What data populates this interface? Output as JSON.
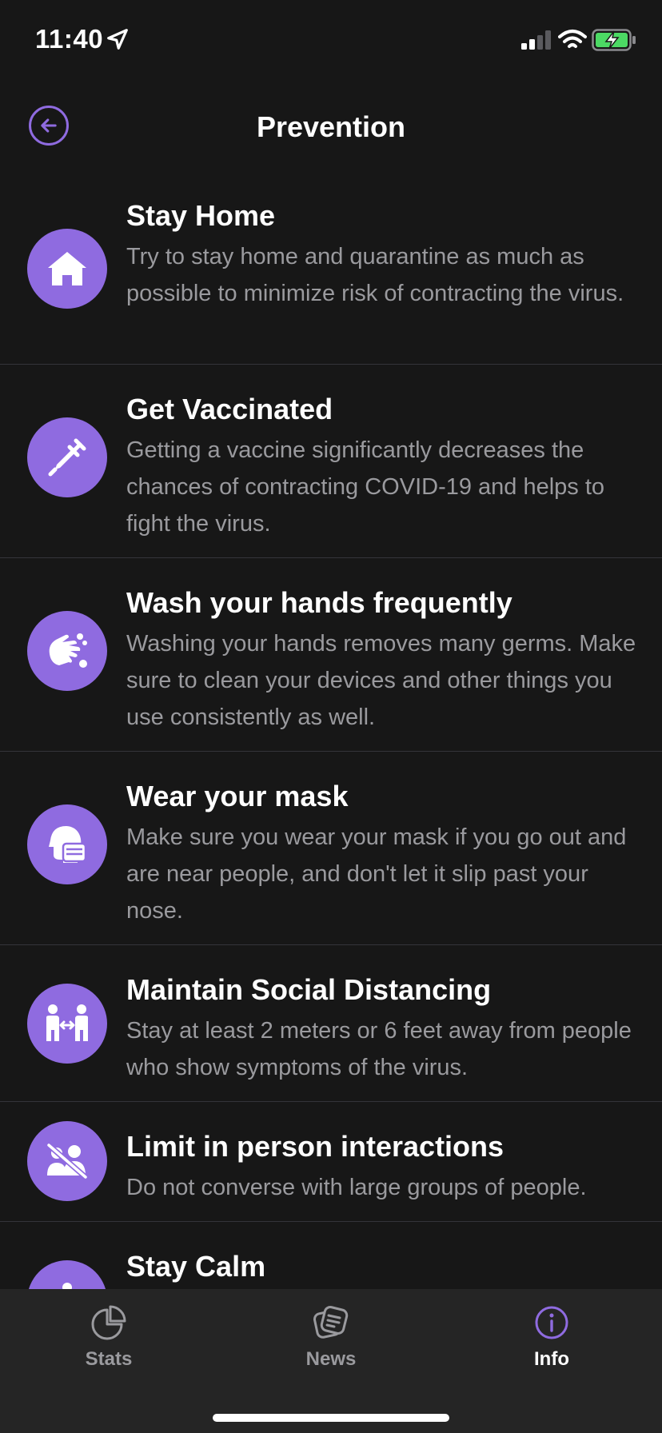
{
  "status_bar": {
    "time": "11:40"
  },
  "header": {
    "title": "Prevention"
  },
  "items": [
    {
      "title": "Stay Home",
      "description": "Try to stay home and quarantine as much as possible to minimize risk of contracting the virus.",
      "icon": "home-icon"
    },
    {
      "title": "Get Vaccinated",
      "description": "Getting a vaccine significantly decreases the chances of contracting COVID-19 and helps to fight the virus.",
      "icon": "syringe-icon"
    },
    {
      "title": "Wash your hands frequently",
      "description": "Washing your hands removes many germs. Make sure to clean your devices and other things you use consistently as well.",
      "icon": "hand-wash-icon"
    },
    {
      "title": "Wear your mask",
      "description": "Make sure you wear your mask if you go out and are near people, and don't let it slip past your nose.",
      "icon": "mask-icon"
    },
    {
      "title": "Maintain Social Distancing",
      "description": "Stay at least 2 meters or 6 feet away from people who show symptoms of the virus.",
      "icon": "social-distance-icon"
    },
    {
      "title": "Limit in person interactions",
      "description": "Do not converse with large groups of people.",
      "icon": "no-groups-icon"
    },
    {
      "title": "Stay Calm",
      "description": "",
      "icon": "calm-icon"
    }
  ],
  "tabs": [
    {
      "label": "Stats",
      "icon": "pie-chart-icon",
      "active": false
    },
    {
      "label": "News",
      "icon": "news-icon",
      "active": false
    },
    {
      "label": "Info",
      "icon": "info-icon",
      "active": true
    }
  ],
  "colors": {
    "accent": "#8f6be0",
    "background": "#171717",
    "tabbar": "#252525",
    "secondary_text": "#9a9a9e"
  }
}
